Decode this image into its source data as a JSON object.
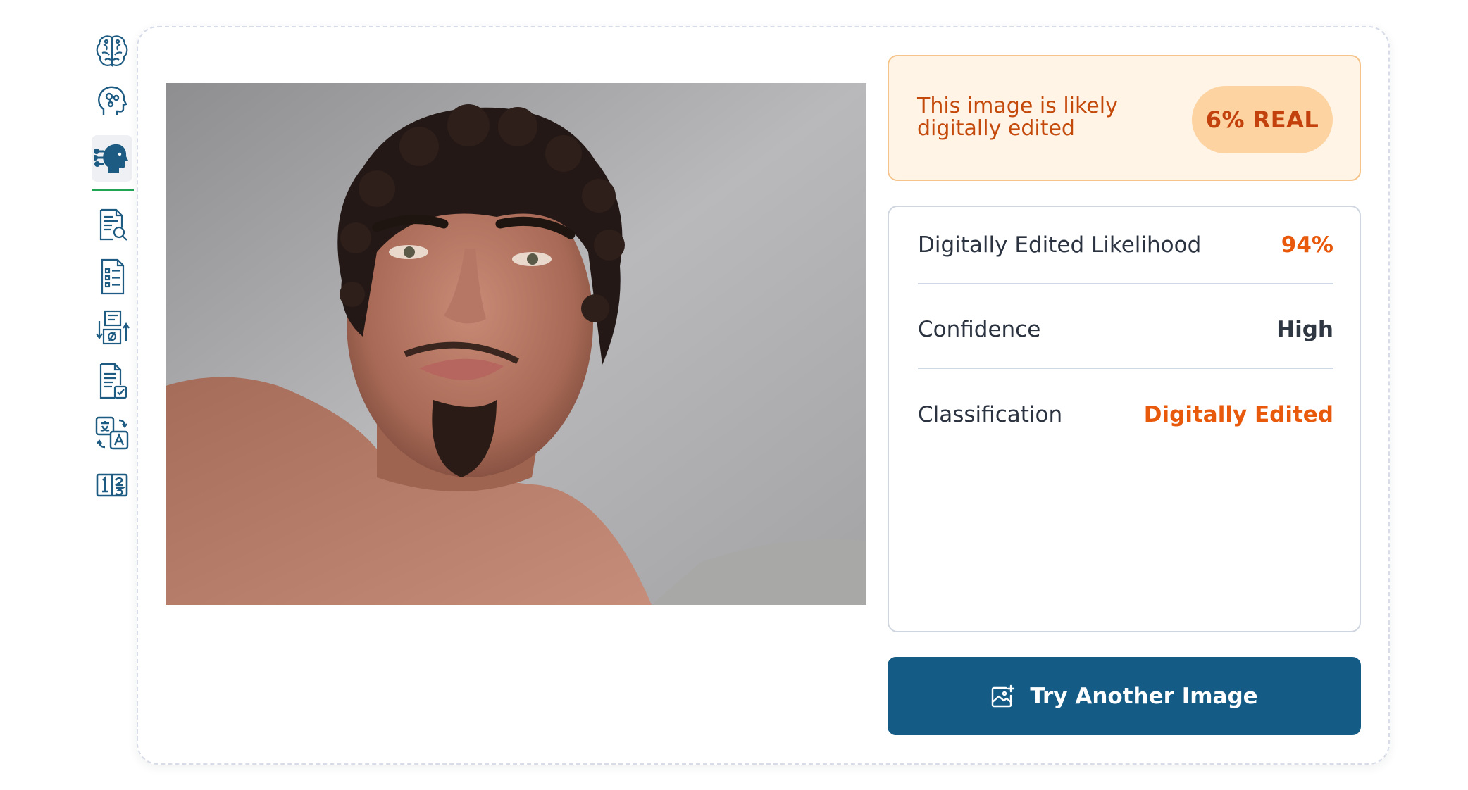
{
  "sidebar": {
    "items": [
      {
        "icon": "brain-icon"
      },
      {
        "icon": "ai-head-icon"
      },
      {
        "icon": "face-circuit-icon",
        "active": true
      },
      {
        "icon": "document-search-icon"
      },
      {
        "icon": "document-list-icon"
      },
      {
        "icon": "document-process-icon"
      },
      {
        "icon": "document-check-icon"
      },
      {
        "icon": "translate-icon"
      },
      {
        "icon": "fraction-icon"
      }
    ]
  },
  "result": {
    "message": "This image is likely digitally edited",
    "badge": "6% REAL"
  },
  "details": [
    {
      "label": "Digitally Edited Likelihood",
      "value": "94%"
    },
    {
      "label": "Confidence",
      "value": "High"
    },
    {
      "label": "Classification",
      "value": "Digitally Edited"
    }
  ],
  "action": {
    "label": "Try Another Image",
    "icon": "image-add-icon"
  },
  "colors": {
    "accent": "#145c85",
    "warning_text": "#c44a0c",
    "warning_bg": "#fff4e6",
    "highlight": "#e8590c",
    "active_indicator": "#23a455"
  }
}
